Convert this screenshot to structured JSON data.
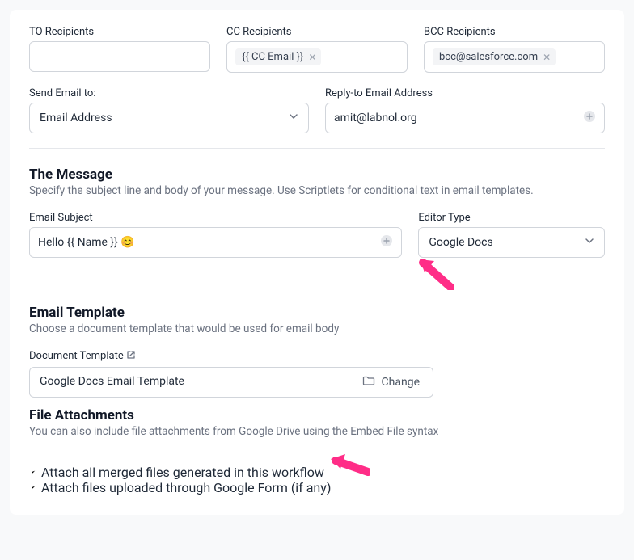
{
  "recipients": {
    "to_label": "TO Recipients",
    "cc_label": "CC Recipients",
    "cc_chip": "{{ CC Email }}",
    "bcc_label": "BCC Recipients",
    "bcc_chip": "bcc@salesforce.com"
  },
  "send_to": {
    "label": "Send Email to:",
    "value": "Email Address"
  },
  "reply_to": {
    "label": "Reply-to Email Address",
    "value": "amit@labnol.org"
  },
  "message": {
    "title": "The Message",
    "subtitle": "Specify the subject line and body of your message. Use Scriptlets for conditional text in email templates."
  },
  "subject": {
    "label": "Email Subject",
    "value": "Hello {{ Name }} 😊"
  },
  "editor": {
    "label": "Editor Type",
    "value": "Google Docs"
  },
  "template": {
    "title": "Email Template",
    "subtitle": "Choose a document template that would be used for email body",
    "doc_label": "Document Template",
    "doc_value": "Google Docs Email Template",
    "change_label": "Change"
  },
  "attachments": {
    "title": "File Attachments",
    "subtitle": "You can also include file attachments from Google Drive using the Embed File syntax",
    "opt1": "Attach all merged files generated in this workflow",
    "opt2": "Attach files uploaded through Google Form (if any)"
  }
}
